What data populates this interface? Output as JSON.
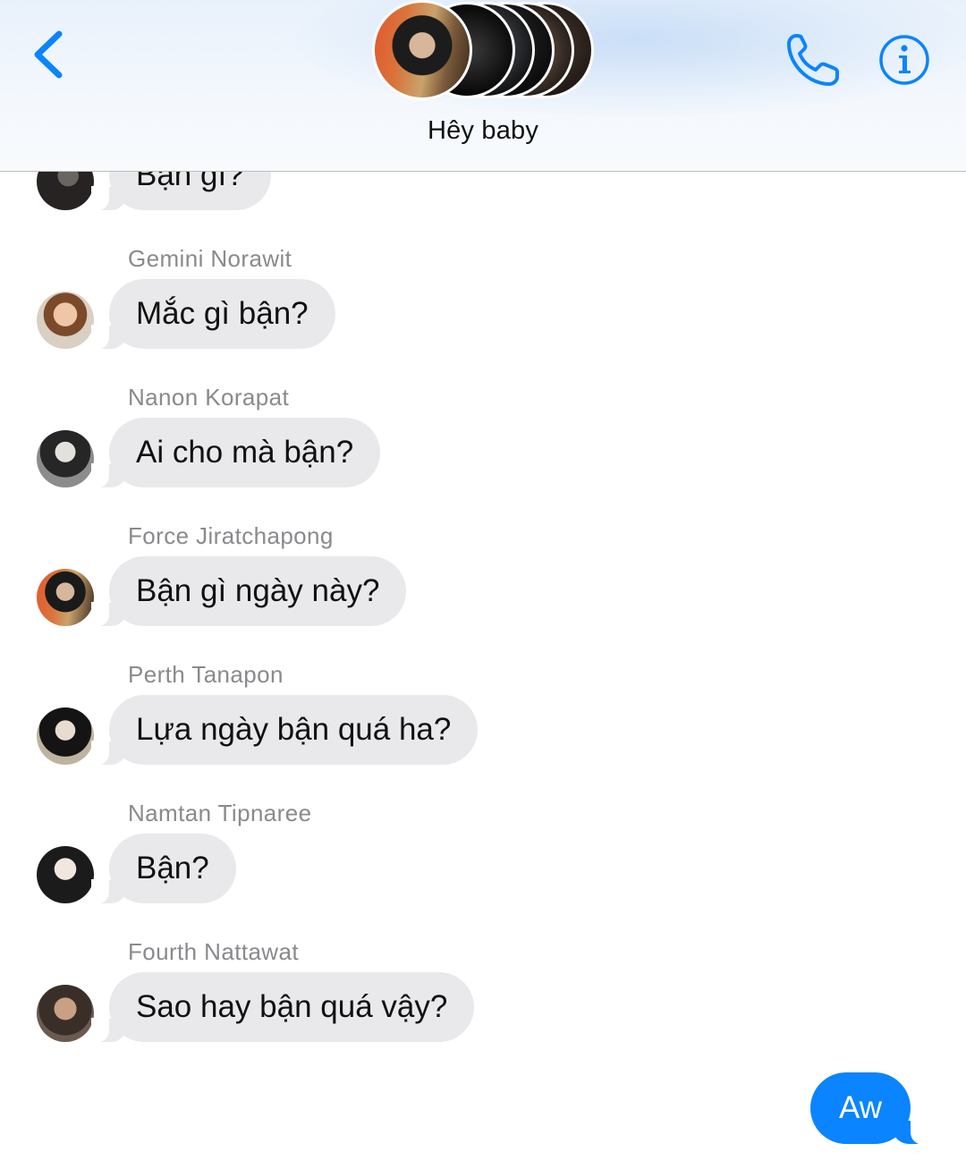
{
  "header": {
    "group_name": "Hêy baby",
    "back_icon": "chevron-left-icon",
    "call_icon": "phone-icon",
    "info_icon": "info-icon",
    "accent_color": "#0a84ff"
  },
  "messages": [
    {
      "sender": "",
      "text": "Bạn gì?",
      "avatar": "avatar-icon"
    },
    {
      "sender": "Gemini Norawit",
      "text": "Mắc gì bận?",
      "avatar": "avatar-icon"
    },
    {
      "sender": "Nanon Korapat",
      "text": "Ai cho mà bận?",
      "avatar": "avatar-icon"
    },
    {
      "sender": "Force Jiratchapong",
      "text": "Bận gì ngày này?",
      "avatar": "avatar-icon"
    },
    {
      "sender": "Perth Tanapon",
      "text": "Lựa ngày bận quá ha?",
      "avatar": "avatar-icon"
    },
    {
      "sender": "Namtan Tipnaree",
      "text": "Bận?",
      "avatar": "avatar-icon"
    },
    {
      "sender": "Fourth Nattawat",
      "text": "Sao hay bận quá vậy?",
      "avatar": "avatar-icon"
    }
  ],
  "outgoing": {
    "text": "Aw",
    "color": "#0a84ff"
  },
  "colors": {
    "incoming_bubble": "#e9e9eb",
    "sender_name": "#8a8a8e"
  }
}
